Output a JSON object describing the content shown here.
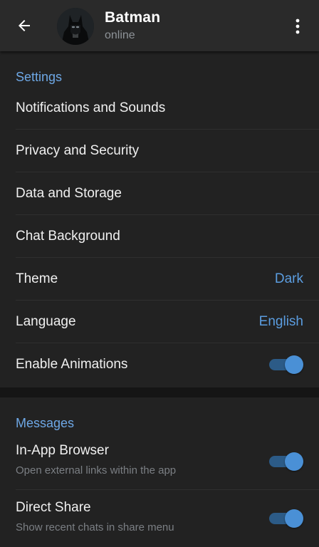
{
  "header": {
    "title": "Batman",
    "status": "online",
    "back_icon": "arrow-left-icon",
    "menu_icon": "kebab-menu-icon"
  },
  "settings": {
    "section_title": "Settings",
    "items": [
      {
        "label": "Notifications and Sounds"
      },
      {
        "label": "Privacy and Security"
      },
      {
        "label": "Data and Storage"
      },
      {
        "label": "Chat Background"
      },
      {
        "label": "Theme",
        "value": "Dark"
      },
      {
        "label": "Language",
        "value": "English"
      },
      {
        "label": "Enable Animations",
        "toggle": true
      }
    ]
  },
  "messages": {
    "section_title": "Messages",
    "items": [
      {
        "label": "In-App Browser",
        "subtitle": "Open external links within the app",
        "toggle": true
      },
      {
        "label": "Direct Share",
        "subtitle": "Show recent chats in share menu",
        "toggle": true
      }
    ]
  },
  "colors": {
    "accent": "#5b9de0",
    "section_header": "#6ea8e6",
    "toggle_on_thumb": "#4a90d6",
    "toggle_on_track": "#2c5b87",
    "background": "#222222",
    "header_bg": "#2a2a2a"
  }
}
